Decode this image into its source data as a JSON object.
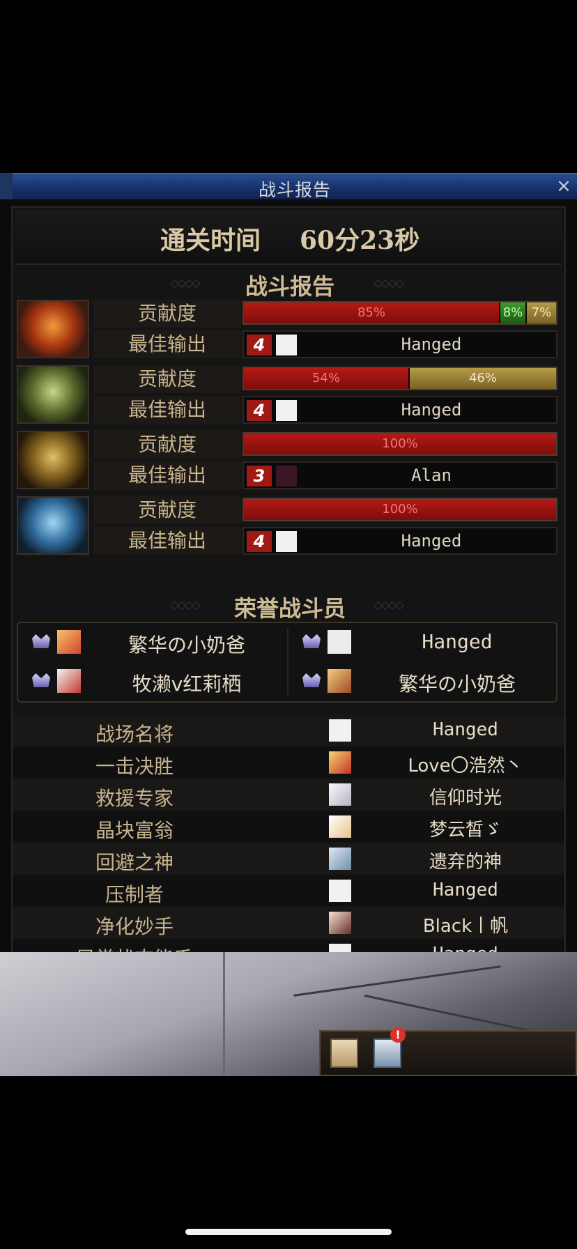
{
  "window": {
    "title": "战斗报告",
    "close_glyph": "×"
  },
  "clear_time": {
    "label": "通关时间",
    "value": "60分23秒"
  },
  "section_report": "战斗报告",
  "section_honor": "荣誉战斗员",
  "row_labels": {
    "contribution": "贡献度",
    "best_output": "最佳输出"
  },
  "reports": [
    {
      "icon": "flame-helmet-icon",
      "bars": [
        {
          "label": "85%",
          "value": 85,
          "color": "red"
        },
        {
          "label": "8%",
          "value": 8,
          "color": "green"
        },
        {
          "label": "7%",
          "value": 7,
          "color": "gold"
        }
      ],
      "output_rank": "4",
      "best_player": "Hanged"
    },
    {
      "icon": "green-armor-icon",
      "bars": [
        {
          "label": "54%",
          "value": 54,
          "color": "red"
        },
        {
          "label": "46%",
          "value": 46,
          "color": "gold"
        }
      ],
      "output_rank": "4",
      "best_player": "Hanged"
    },
    {
      "icon": "gold-armor-icon",
      "bars": [
        {
          "label": "100%",
          "value": 100,
          "color": "red"
        }
      ],
      "output_rank": "3",
      "best_player": "Alan"
    },
    {
      "icon": "ice-armor-icon",
      "bars": [
        {
          "label": "100%",
          "value": 100,
          "color": "red"
        }
      ],
      "output_rank": "4",
      "best_player": "Hanged"
    }
  ],
  "honor": [
    {
      "name": "繁华の小奶爸"
    },
    {
      "name": "Hanged"
    },
    {
      "name": "牧濑v红莉栖"
    },
    {
      "name": "繁华の小奶爸"
    }
  ],
  "awards": [
    {
      "title": "战场名将",
      "player": "Hanged"
    },
    {
      "title": "一击决胜",
      "player": "Love〇浩然丶"
    },
    {
      "title": "救援专家",
      "player": "信仰时光"
    },
    {
      "title": "晶块富翁",
      "player": "梦云皙ゞ"
    },
    {
      "title": "回避之神",
      "player": "遗弃的神"
    },
    {
      "title": "压制者",
      "player": "Hanged"
    },
    {
      "title": "净化妙手",
      "player": "Black丨帆"
    },
    {
      "title": "异常状态能手",
      "player": "Hanged"
    }
  ],
  "dock": {
    "notification_badge": "!"
  }
}
